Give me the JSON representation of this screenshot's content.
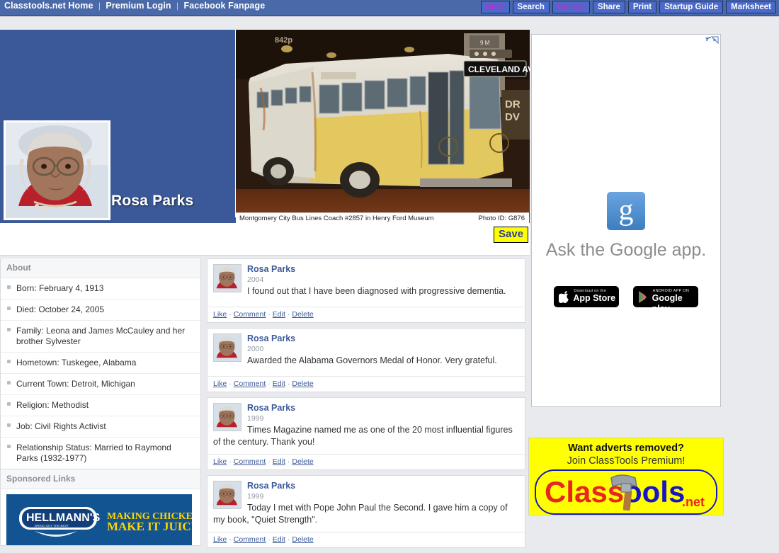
{
  "header": {
    "left_links": [
      {
        "label": "Classtools.net Home"
      },
      {
        "label": "Premium Login"
      },
      {
        "label": "Facebook Fanpage"
      }
    ],
    "separator": "|",
    "nav_buttons": [
      {
        "label": "NEW",
        "accent": true
      },
      {
        "label": "Search",
        "accent": false
      },
      {
        "label": "Gallery",
        "accent": true
      },
      {
        "label": "Share",
        "accent": false
      },
      {
        "label": "Print",
        "accent": false
      },
      {
        "label": "Startup Guide",
        "accent": false
      },
      {
        "label": "Marksheet",
        "accent": false
      }
    ],
    "bar_color": "#4a69a8",
    "button_color": "#4a69c8",
    "accent_color": "#a83ad0"
  },
  "cover": {
    "profile_name": "Rosa Parks",
    "caption": "Montgomery City Bus Lines Coach #2857 in Henry Ford Museum",
    "photo_id": "Photo ID: G876",
    "bus_sign": "CLEVELAND AVE.",
    "band_color": "#3b5998"
  },
  "toolbar": {
    "save_label": "Save",
    "save_bg": "#ffff00",
    "save_color": "#2b3f9e"
  },
  "sidebar": {
    "about_title": "About",
    "about_items": [
      {
        "label": "Born: February 4, 1913"
      },
      {
        "label": "Died: October 24, 2005"
      },
      {
        "label": "Family: Leona and James McCauley and her brother Sylvester"
      },
      {
        "label": "Hometown: Tuskegee, Alabama"
      },
      {
        "label": "Current Town: Detroit, Michigan"
      },
      {
        "label": "Religion: Methodist"
      },
      {
        "label": "Job: Civil Rights Activist"
      },
      {
        "label": "Relationship Status: Married to Raymond Parks (1932-1977)"
      }
    ],
    "sponsored_title": "Sponsored Links",
    "sponsored_ad": {
      "brand": "HELLMANN'S",
      "brand_sub": "BRING OUT THE BEST",
      "line1": "MAKING CHICKEN?",
      "line2": "MAKE IT JUICY"
    }
  },
  "feed": {
    "actions": [
      {
        "label": "Like"
      },
      {
        "label": "Comment"
      },
      {
        "label": "Edit"
      },
      {
        "label": "Delete"
      }
    ],
    "action_separator": "·",
    "posts": [
      {
        "author": "Rosa Parks",
        "date": "2004",
        "text": "I found out that I have been diagnosed with progressive dementia."
      },
      {
        "author": "Rosa Parks",
        "date": "2000",
        "text": "Awarded the Alabama Governors Medal of Honor. Very grateful."
      },
      {
        "author": "Rosa Parks",
        "date": "1999",
        "text": "Times Magazine named me as one of the 20 most influential figures of the century. Thank you!"
      },
      {
        "author": "Rosa Parks",
        "date": "1999",
        "text": "Today I met with Pope John Paul the Second. I gave him a copy of my book, \"Quiet Strength\"."
      }
    ]
  },
  "ads": {
    "google_ad": {
      "logo_letter": "g",
      "tagline": "Ask the Google app.",
      "apple_badge_top": "Download on the",
      "apple_badge_main": "App Store",
      "google_badge_top": "ANDROID APP ON",
      "google_badge_main": "Google",
      "google_badge_main2": "play"
    },
    "premium_ad": {
      "line1": "Want adverts removed?",
      "line2": "Join ClassTools Premium!",
      "logo_part1": "Class",
      "logo_part2": "ools",
      "logo_suffix": ".net",
      "bg": "#ffff00"
    }
  }
}
